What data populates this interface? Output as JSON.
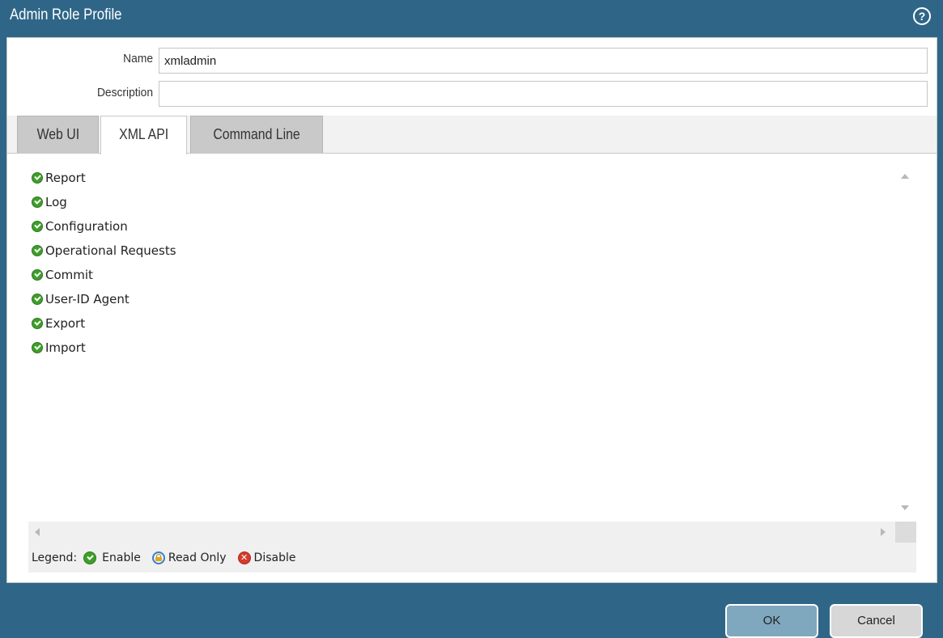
{
  "dialog": {
    "title": "Admin Role Profile",
    "help_icon": "help-icon",
    "help_glyph": "?"
  },
  "form": {
    "name_label": "Name",
    "name_value": "xmladmin",
    "description_label": "Description",
    "description_value": ""
  },
  "tabs": [
    {
      "label": "Web UI",
      "active": false
    },
    {
      "label": "XML API",
      "active": true
    },
    {
      "label": "Command Line",
      "active": false
    }
  ],
  "permissions": [
    {
      "label": "Report",
      "state": "enable"
    },
    {
      "label": "Log",
      "state": "enable"
    },
    {
      "label": "Configuration",
      "state": "enable"
    },
    {
      "label": "Operational Requests",
      "state": "enable"
    },
    {
      "label": "Commit",
      "state": "enable"
    },
    {
      "label": "User-ID Agent",
      "state": "enable"
    },
    {
      "label": "Export",
      "state": "enable"
    },
    {
      "label": "Import",
      "state": "enable"
    }
  ],
  "legend": {
    "title": "Legend:",
    "enable": "Enable",
    "read_only": "Read Only",
    "disable": "Disable",
    "disable_glyph": "✕"
  },
  "buttons": {
    "ok": "OK",
    "cancel": "Cancel"
  },
  "colors": {
    "header": "#2f6687",
    "enable": "#3f9e2b",
    "read_only": "#3d7fc6",
    "disable": "#d63b2a"
  }
}
